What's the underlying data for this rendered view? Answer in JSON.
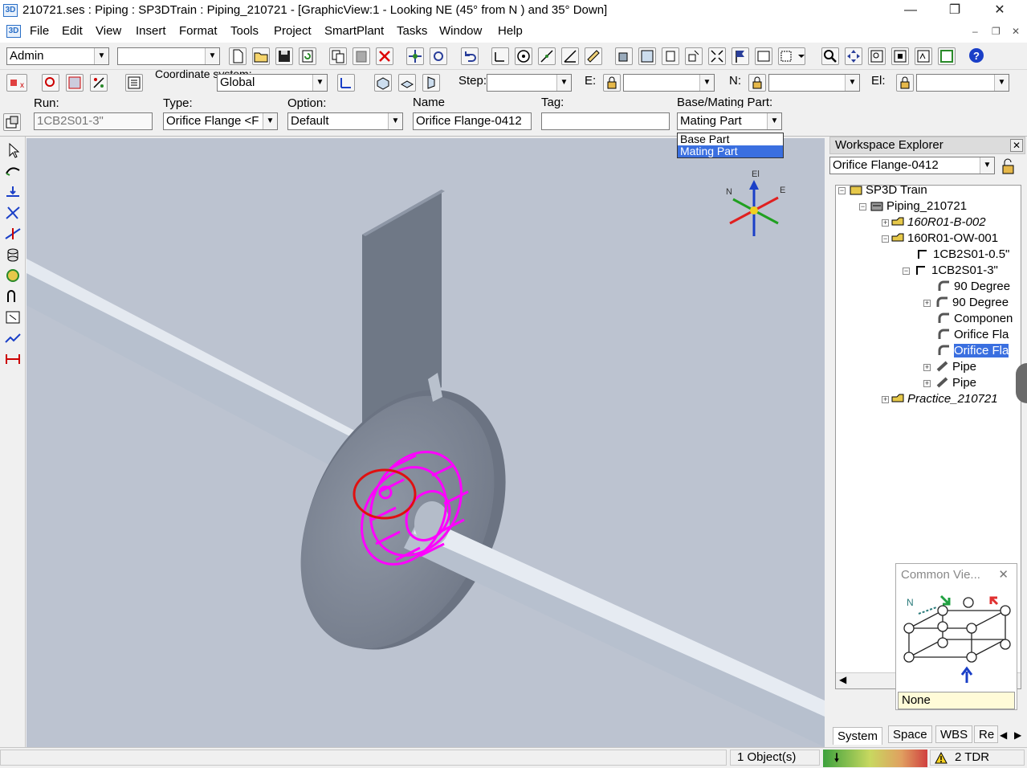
{
  "window": {
    "title": "210721.ses : Piping : SP3DTrain : Piping_210721 - [GraphicView:1 - Looking NE (45° from N ) and 35° Down]",
    "icon_text": "3D",
    "minimize": "—",
    "restore": "❐",
    "close": "✕"
  },
  "menu": {
    "items": [
      "File",
      "Edit",
      "View",
      "Insert",
      "Format",
      "Tools",
      "Project",
      "SmartPlant",
      "Tasks",
      "Window",
      "Help"
    ],
    "mdi_min": "–",
    "mdi_restore": "❐",
    "mdi_close": "✕"
  },
  "toolbar1": {
    "permission_group": "Admin",
    "second_combo": ""
  },
  "toolbar2": {
    "coordinate_system_label": "Coordinate system:",
    "coordinate_system": "Global",
    "step_label": "Step:",
    "step_value": "",
    "e_label": "E:",
    "e_value": "",
    "n_label": "N:",
    "n_value": "",
    "el_label": "El:",
    "el_value": ""
  },
  "toolbar3": {
    "run_label": "Run:",
    "run_value": "1CB2S01-3\"",
    "type_label": "Type:",
    "type_value": "Orifice Flange <F",
    "option_label": "Option:",
    "option_value": "Default",
    "name_label": "Name",
    "name_value": "Orifice Flange-0412",
    "tag_label": "Tag:",
    "tag_value": "",
    "base_mating_label": "Base/Mating Part:",
    "base_mating_value": "Mating Part",
    "dropdown_options": [
      "Base Part",
      "Mating Part"
    ]
  },
  "viewport": {
    "compass": {
      "el": "El",
      "n": "N",
      "e": "E"
    }
  },
  "explorer": {
    "title": "Workspace Explorer",
    "filter_value": "Orifice Flange-0412",
    "tree": [
      {
        "label": "SP3D Train"
      },
      {
        "label": "Piping_210721"
      },
      {
        "label": "160R01-B-002"
      },
      {
        "label": "160R01-OW-001"
      },
      {
        "label": "1CB2S01-0.5\""
      },
      {
        "label": "1CB2S01-3\""
      },
      {
        "label": "90 Degree"
      },
      {
        "label": "90 Degree"
      },
      {
        "label": "Componen"
      },
      {
        "label": "Orifice Fla"
      },
      {
        "label": "Orifice Fla"
      },
      {
        "label": "Pipe"
      },
      {
        "label": "Pipe"
      },
      {
        "label": "Practice_210721"
      }
    ],
    "common_views": {
      "title": "Common Vie...",
      "close": "✕",
      "north_label": "N",
      "value": "None"
    },
    "tabs": [
      "System",
      "Space",
      "WBS",
      "Re"
    ]
  },
  "status": {
    "objects": "1 Object(s)",
    "tdr": "2 TDR"
  },
  "colors": {
    "selection_magenta": "#ff00ff",
    "annotation_red": "#e01010",
    "viewport_bg": "#bcc3d0",
    "highlight_blue": "#3a6fe0"
  }
}
